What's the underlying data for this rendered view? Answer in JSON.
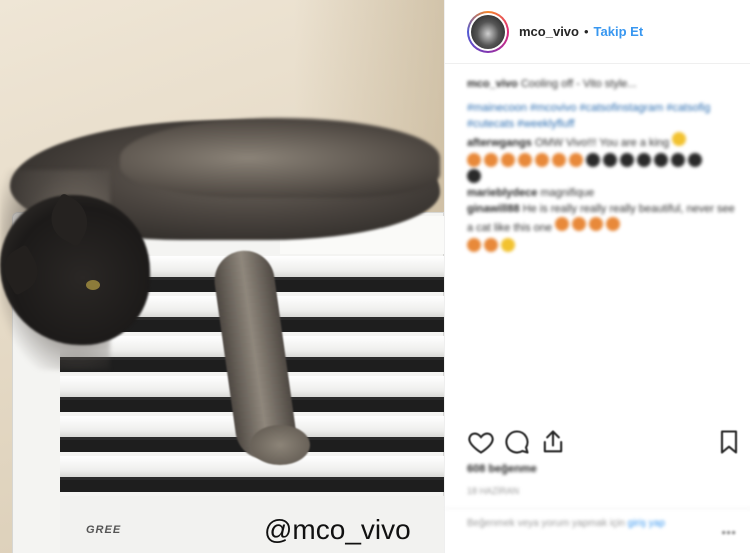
{
  "post": {
    "watermark": "@mco_vivo",
    "brand": "GREE"
  },
  "header": {
    "username": "mco_vivo",
    "separator": "•",
    "follow_label": "Takip Et"
  },
  "comments": [
    {
      "user": "mco_vivo",
      "text": "Cooling off - Vito style..."
    },
    {
      "user": "",
      "text": "#mainecoon #mcovivo #catsofinstagram #catsofig #cutecats #weeklyfluff",
      "tag": true
    },
    {
      "user": "afterwgangs",
      "text": "OMW Vivo!!! You are a king"
    },
    {
      "user": "marieblydece",
      "text": "magnifique"
    },
    {
      "user": "ginawill88",
      "text": "He is really really really beautiful, never see a cat like this one"
    }
  ],
  "likes": "608 beğenme",
  "time": "18 HAZİRAN",
  "add_comment": {
    "prefix": "Beğenmek veya yorum yapmak için",
    "login": "giriş yap"
  },
  "more": "•••",
  "icons": {
    "like": "heart-icon",
    "comment": "comment-icon",
    "share": "share-icon",
    "save": "bookmark-icon"
  }
}
